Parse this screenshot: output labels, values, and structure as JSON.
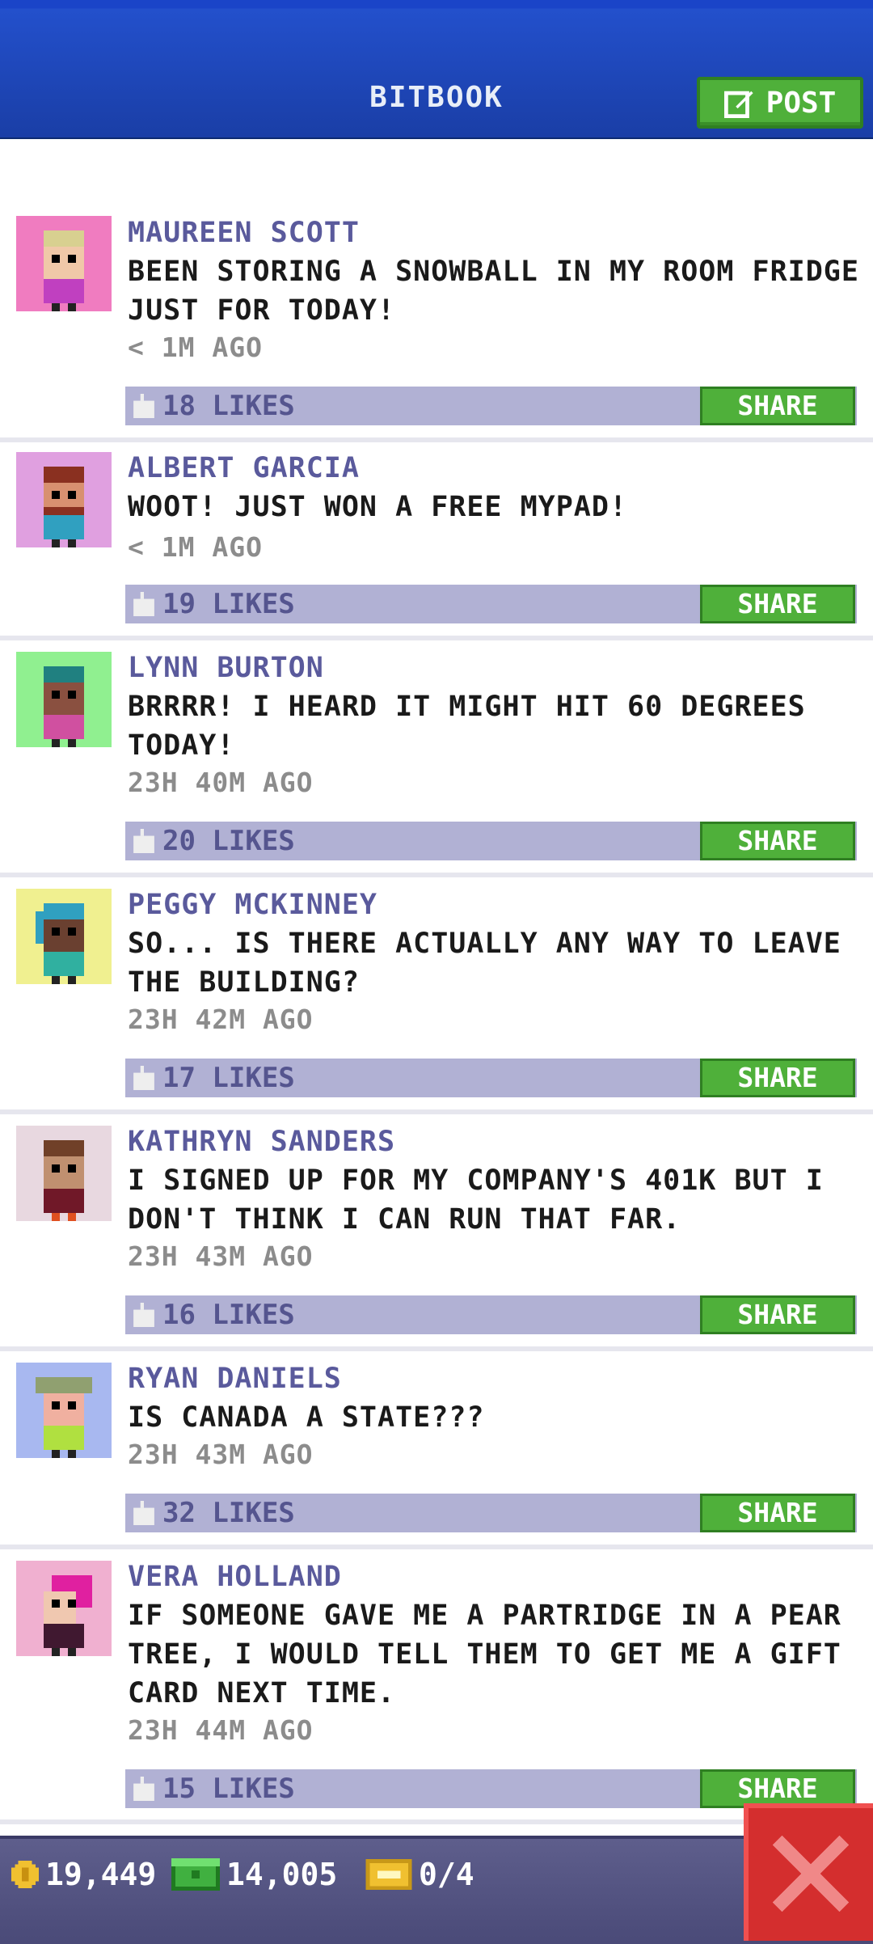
{
  "header": {
    "title": "BITBOOK",
    "post_label": "POST"
  },
  "posts": [
    {
      "name": "MAUREEN SCOTT",
      "message": "BEEN STORING A SNOWBALL IN MY ROOM FRIDGE JUST FOR TODAY!",
      "time": "< 1M AGO",
      "likes": "18 LIKES",
      "share": "SHARE",
      "avatar_bg": "#f07cc0",
      "skin": "#f0c8a8",
      "hair": "#d8d090",
      "shirt": "#c040c0"
    },
    {
      "name": "ALBERT GARCIA",
      "message": "WOOT! JUST WON A FREE MYPAD!",
      "time": "< 1M AGO",
      "likes": "19 LIKES",
      "share": "SHARE",
      "avatar_bg": "#e0a0e0",
      "skin": "#d89070",
      "hair": "#8a3020",
      "shirt": "#30a0c0"
    },
    {
      "name": "LYNN BURTON",
      "message": "BRRRR! I HEARD IT MIGHT HIT 60 DEGREES TODAY!",
      "time": "23H 40M AGO",
      "likes": "20 LIKES",
      "share": "SHARE",
      "avatar_bg": "#90f090",
      "skin": "#8a5040",
      "hair": "#208080",
      "shirt": "#d050a0"
    },
    {
      "name": "PEGGY MCKINNEY",
      "message": "SO... IS THERE ACTUALLY ANY WAY TO LEAVE THE BUILDING?",
      "time": "23H 42M AGO",
      "likes": "17 LIKES",
      "share": "SHARE",
      "avatar_bg": "#f0f090",
      "skin": "#6a4030",
      "hair": "#30a0c0",
      "shirt": "#30b0a0"
    },
    {
      "name": "KATHRYN SANDERS",
      "message": "I SIGNED UP FOR MY COMPANY'S 401K BUT I DON'T THINK I CAN RUN THAT FAR.",
      "time": "23H 43M AGO",
      "likes": "16 LIKES",
      "share": "SHARE",
      "avatar_bg": "#e8d8e0",
      "skin": "#c09070",
      "hair": "#704028",
      "shirt": "#701828"
    },
    {
      "name": "RYAN DANIELS",
      "message": "IS CANADA A STATE???",
      "time": "23H 43M AGO",
      "likes": "32 LIKES",
      "share": "SHARE",
      "avatar_bg": "#a8b8f0",
      "skin": "#f0b0a0",
      "hair": "#90a070",
      "shirt": "#b0e040"
    },
    {
      "name": "VERA HOLLAND",
      "message": "IF SOMEONE GAVE ME A PARTRIDGE IN A PEAR TREE, I WOULD TELL THEM TO GET ME A GIFT CARD NEXT TIME.",
      "time": "23H 44M AGO",
      "likes": "15 LIKES",
      "share": "SHARE",
      "avatar_bg": "#f0b0d0",
      "skin": "#f0c8b0",
      "hair": "#e020a0",
      "shirt": "#401830"
    }
  ],
  "footer": {
    "coins": "19,449",
    "bux": "14,005",
    "tickets": "0/4"
  },
  "colors": {
    "accent_green": "#4fb03a",
    "header_blue": "#1a3ea6",
    "like_bar": "#b1b1d4",
    "close_red": "#d42e2e"
  }
}
